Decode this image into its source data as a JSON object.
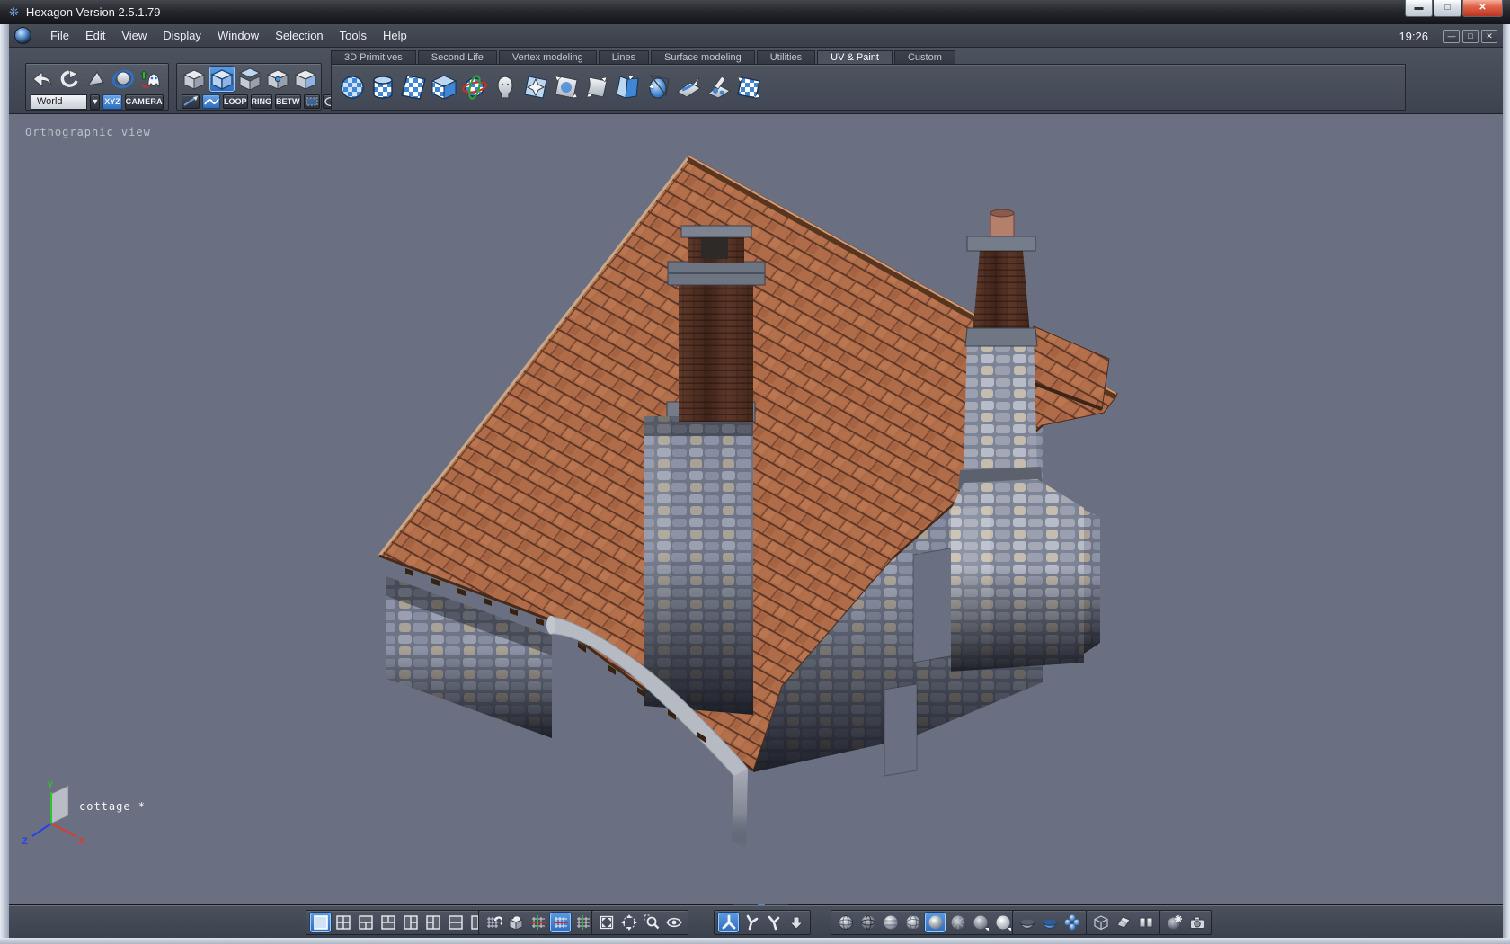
{
  "window": {
    "title": "Hexagon Version 2.5.1.79",
    "clock": "19:26"
  },
  "menubar": {
    "items": [
      "File",
      "Edit",
      "View",
      "Display",
      "Window",
      "Selection",
      "Tools",
      "Help"
    ]
  },
  "tabs": [
    {
      "label": "3D Primitives"
    },
    {
      "label": "Second Life"
    },
    {
      "label": "Vertex modeling"
    },
    {
      "label": "Lines"
    },
    {
      "label": "Surface modeling"
    },
    {
      "label": "Utilities"
    },
    {
      "label": "UV & Paint"
    },
    {
      "label": "Custom"
    }
  ],
  "active_tab": "UV & Paint",
  "transform_bar": {
    "space": "World",
    "xyz": "XYZ",
    "camera": "CAMERA"
  },
  "selection_bar": {
    "loop": "LOOP",
    "ring": "RING",
    "betw": "BETW"
  },
  "viewport": {
    "view_label": "Orthographic view",
    "object_name": "cottage *",
    "axis_x": "X",
    "axis_y": "Y",
    "axis_z": "Z"
  },
  "icons": {
    "history_group": [
      "undo-arrow",
      "redo-arrow",
      "cone-tool",
      "ring-sphere",
      "ghost-helper"
    ],
    "selection_modes": [
      "select-object-cube",
      "select-edges-cube",
      "select-faces-cube",
      "select-points-cube",
      "select-side-face-cube"
    ],
    "selection_extras": [
      "paint-select-brush",
      "lasso-curve",
      "marquee-rect",
      "marquee-ellipse"
    ],
    "uv_paint_tools": [
      "spherical-uv",
      "cylindrical-uv",
      "planar-uv",
      "cubic-uv",
      "globe-uv-projection",
      "unfold-mesh",
      "pinch-uv",
      "stretch-uv",
      "relax-uv",
      "flip-uv",
      "inflate-uv",
      "paint-on-plane",
      "paint-tools",
      "checker-preview"
    ],
    "bottom_layouts": [
      "single-view",
      "quad-view",
      "one-top-two-bottom",
      "two-top-one-bottom",
      "one-left-two-right",
      "two-left-one-right",
      "two-rows",
      "two-columns"
    ],
    "bottom_grid": [
      "snap-grid",
      "lock-grid",
      "grid-xy",
      "grid-x",
      "grid-y"
    ],
    "bottom_view": [
      "fit-view",
      "pan-view",
      "zoom-region",
      "orbit-view"
    ],
    "bottom_manipulators": [
      "translate-manipulator",
      "rotate-manipulator",
      "scale-manipulator",
      "drop-to-ground"
    ],
    "bottom_shading": [
      "wireframe",
      "hidden-line",
      "flat-shading",
      "shaded-wireframe",
      "smooth-shading",
      "textured-wireframe",
      "smooth-alt",
      "smooth-bright"
    ],
    "bottom_display": [
      "half-sphere-low",
      "half-sphere-smooth",
      "multi-resolution"
    ],
    "bottom_misc": [
      "ghost-cube",
      "unfold-preview",
      "uv-pages"
    ],
    "bottom_render": [
      "render-sparkle",
      "render-camera"
    ]
  },
  "colors": {
    "accent_blue": "#3f84d8",
    "selected_bg": "#2f74c4",
    "viewport_bg": "#6a7081",
    "roof_tile": "#b06c49",
    "stone_wall": "#8d93a5",
    "close_button": "#d9462f",
    "titlebar": "#15171b"
  }
}
